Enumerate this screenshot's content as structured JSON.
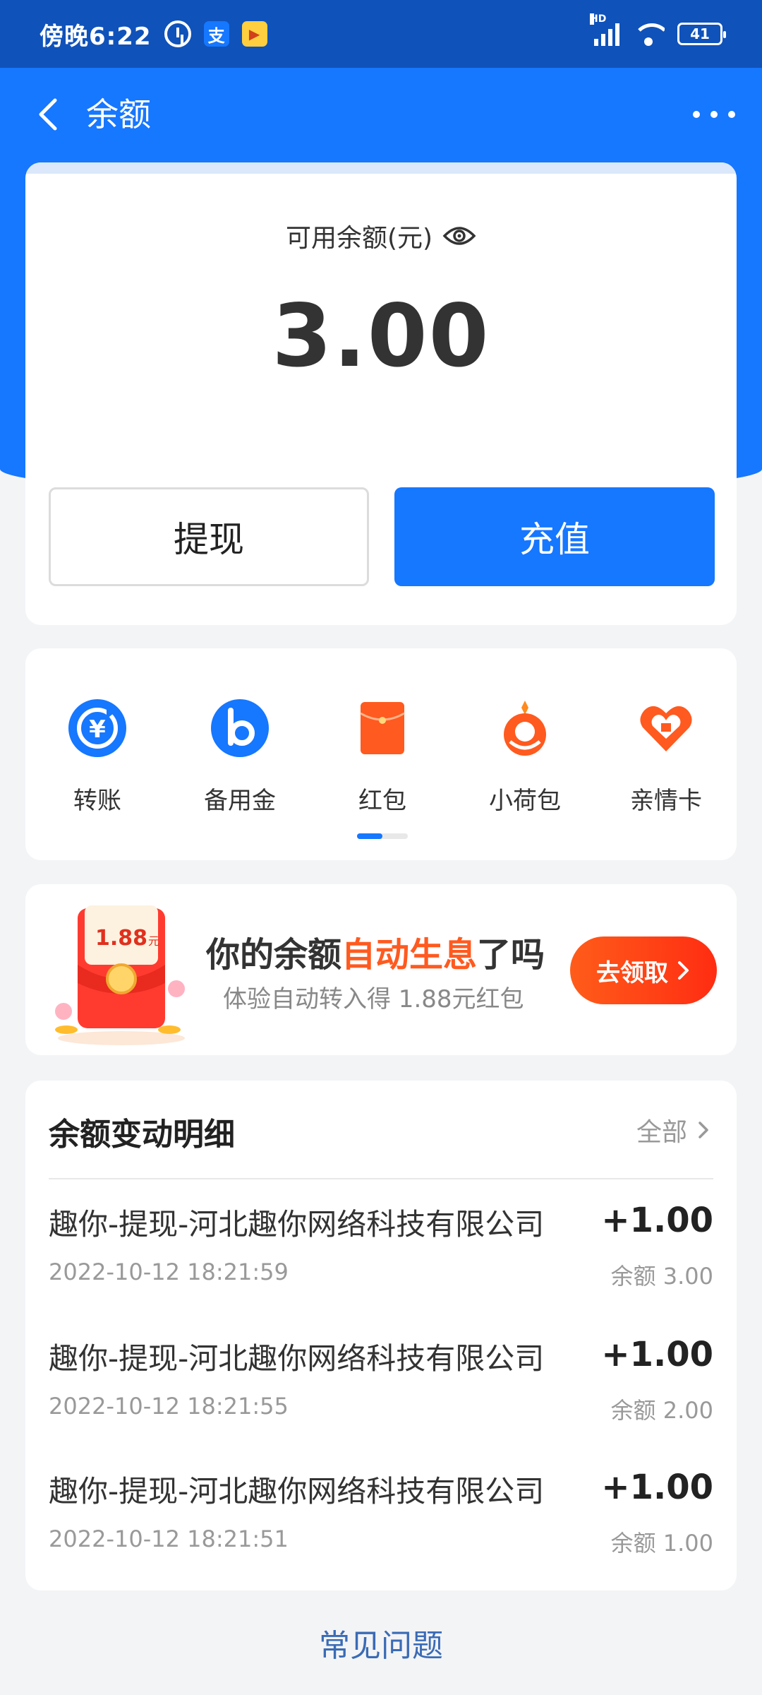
{
  "status_bar": {
    "time": "傍晚6:22",
    "battery": "41",
    "alipay_glyph": "支"
  },
  "nav": {
    "title": "余额"
  },
  "balance": {
    "label": "可用余额(元)",
    "amount": "3.00",
    "withdraw_label": "提现",
    "recharge_label": "充值"
  },
  "shortcuts": [
    {
      "label": "转账",
      "icon": "transfer-icon"
    },
    {
      "label": "备用金",
      "icon": "reserve-fund-icon"
    },
    {
      "label": "红包",
      "icon": "red-packet-icon"
    },
    {
      "label": "小荷包",
      "icon": "small-purse-icon"
    },
    {
      "label": "亲情卡",
      "icon": "family-card-icon"
    }
  ],
  "promo": {
    "image_text": "1.88",
    "image_unit": "元",
    "title_before": "你的余额",
    "title_highlight": "自动生息",
    "title_after": "了吗",
    "subtitle": "体验自动转入得 1.88元红包",
    "button_label": "去领取"
  },
  "detail": {
    "title": "余额变动明细",
    "all_label": "全部",
    "rows": [
      {
        "title": "趣你-提现-河北趣你网络科技有限公司",
        "time": "2022-10-12 18:21:59",
        "amount": "+1.00",
        "balance": "余额 3.00"
      },
      {
        "title": "趣你-提现-河北趣你网络科技有限公司",
        "time": "2022-10-12 18:21:55",
        "amount": "+1.00",
        "balance": "余额 2.00"
      },
      {
        "title": "趣你-提现-河北趣你网络科技有限公司",
        "time": "2022-10-12 18:21:51",
        "amount": "+1.00",
        "balance": "余额 1.00"
      }
    ]
  },
  "faq": {
    "label": "常见问题"
  },
  "colors": {
    "primary": "#1677ff",
    "status_bar": "#0f52ba",
    "accent_orange": "#ff5a1f"
  }
}
